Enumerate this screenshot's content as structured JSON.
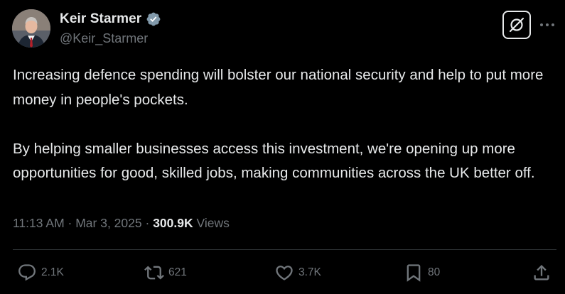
{
  "author": {
    "display_name": "Keir Starmer",
    "handle": "@Keir_Starmer",
    "verified_icon": "verified-badge-icon",
    "avatar_icon": "profile-photo"
  },
  "header_actions": {
    "grok_icon": "grok-icon",
    "more_icon": "more-dots-icon"
  },
  "tweet": {
    "paragraphs": [
      "Increasing defence spending will bolster our national security and help to put more money in people's pockets.",
      "By helping smaller businesses access this investment, we're opening up more opportunities for good, skilled jobs, making communities across the UK better off."
    ],
    "time": "11:13 AM",
    "separator": "·",
    "date": "Mar 3, 2025",
    "views_count": "300.9K",
    "views_label": "Views"
  },
  "engagement": {
    "replies": "2.1K",
    "reposts": "621",
    "likes": "3.7K",
    "bookmarks": "80"
  },
  "colors": {
    "background": "#000000",
    "text_primary": "#e7e9ea",
    "text_secondary": "#71767b",
    "divider": "#2f3336",
    "verified": "#829aab"
  }
}
